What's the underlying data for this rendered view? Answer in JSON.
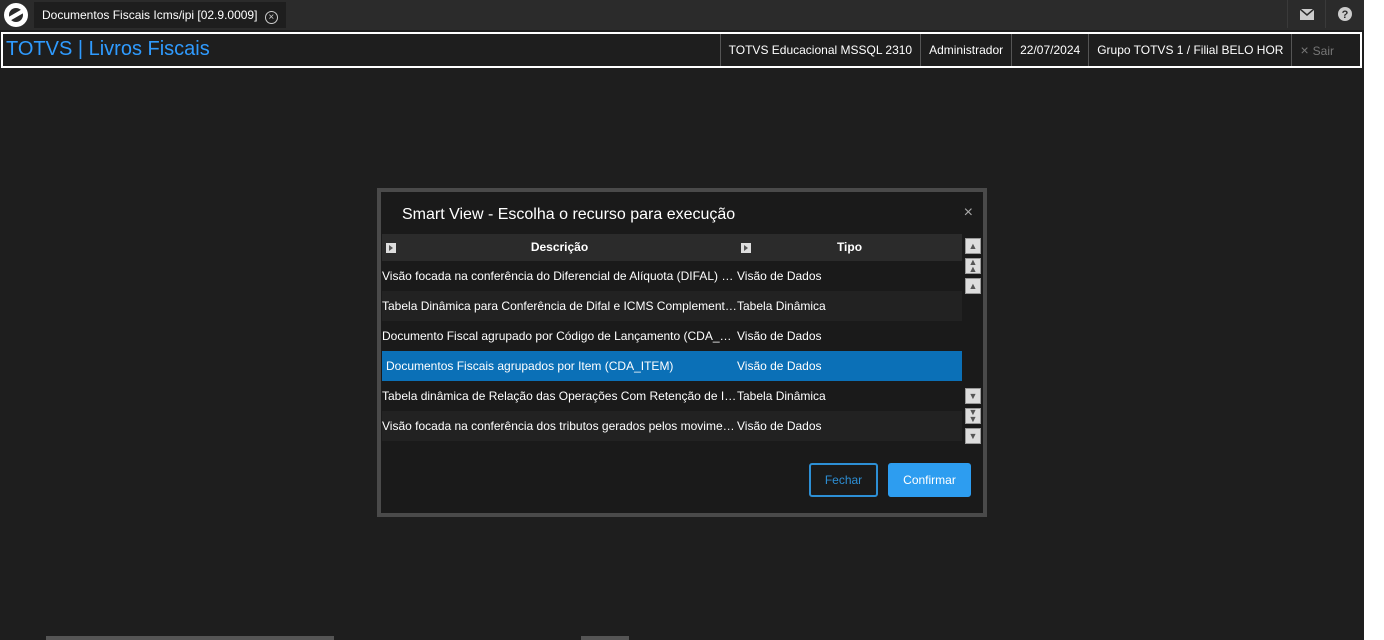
{
  "window": {
    "tab_title": "Documentos Fiscais Icms/ipi [02.9.0009]",
    "tab_close": "×"
  },
  "header": {
    "brand": "TOTVS | Livros Fiscais",
    "environment": "TOTVS Educacional MSSQL 2310",
    "user": "Administrador",
    "date": "22/07/2024",
    "branch": "Grupo TOTVS 1 / Filial BELO HOR",
    "logout": "Sair",
    "logout_icon": "×"
  },
  "modal": {
    "title": "Smart View - Escolha o recurso para execução",
    "close": "×",
    "columns": {
      "descricao": "Descrição",
      "tipo": "Tipo"
    },
    "rows": [
      {
        "descricao": "Visão focada na conferência do Diferencial de Alíquota (DIFAL) e ICMS Complementar",
        "tipo": "Visão de Dados"
      },
      {
        "descricao": "Tabela Dinâmica para Conferência de Difal e ICMS Complementar por Documento",
        "tipo": "Tabela Dinâmica"
      },
      {
        "descricao": "Documento Fiscal agrupado por Código de Lançamento (CDA_CODLAN)",
        "tipo": "Visão de Dados"
      },
      {
        "descricao": "Documentos Fiscais agrupados por Item (CDA_ITEM)",
        "tipo": "Visão de Dados",
        "selected": true
      },
      {
        "descricao": "Tabela dinâmica de Relação das Operações Com Retenção de ICMS ST",
        "tipo": "Tabela Dinâmica"
      },
      {
        "descricao": "Visão focada na conferência dos tributos gerados pelos movimentos fiscais",
        "tipo": "Visão de Dados"
      }
    ],
    "buttons": {
      "fechar": "Fechar",
      "confirmar": "Confirmar"
    }
  },
  "icons": [
    "totvs-logo-icon",
    "mail-icon",
    "help-icon",
    "sort-icon",
    "scroll-top-icon",
    "scroll-page-up-icon",
    "scroll-up-icon",
    "scroll-down-icon",
    "scroll-page-down-icon",
    "scroll-bottom-icon"
  ],
  "colors": {
    "brand": "#2f9bff",
    "selected_row": "#0b70b7",
    "confirm_button": "#2d9df0"
  }
}
